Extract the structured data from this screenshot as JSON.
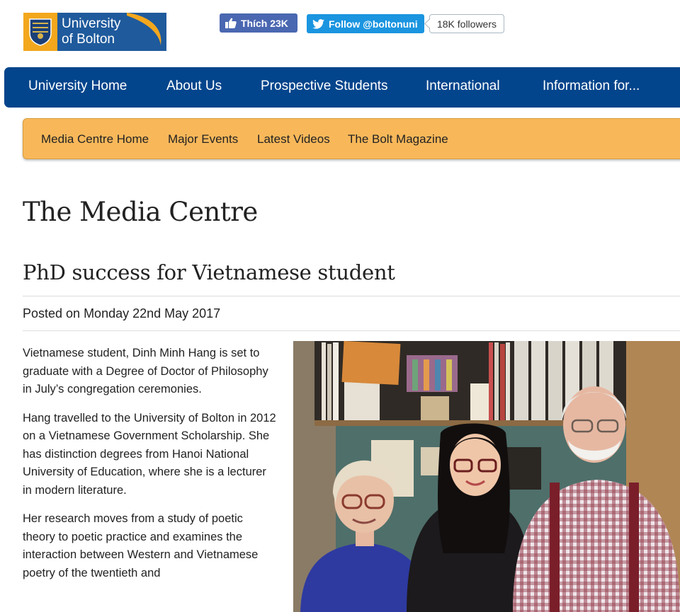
{
  "logo": {
    "line1": "University",
    "line2": "of Bolton"
  },
  "social": {
    "facebook_label": "Thích 23K",
    "twitter_label": "Follow @boltonuni",
    "twitter_count": "18K followers"
  },
  "main_nav": {
    "items": [
      {
        "label": "University Home"
      },
      {
        "label": "About Us"
      },
      {
        "label": "Prospective Students"
      },
      {
        "label": "International"
      },
      {
        "label": "Information for..."
      }
    ]
  },
  "sub_nav": {
    "items": [
      {
        "label": "Media Centre Home"
      },
      {
        "label": "Major Events"
      },
      {
        "label": "Latest Videos"
      },
      {
        "label": "The Bolt Magazine"
      }
    ]
  },
  "page_title": "The Media Centre",
  "article": {
    "title": "PhD success for Vietnamese student",
    "posted": "Posted on Monday 22nd May 2017",
    "paragraphs": [
      "Vietnamese student, Dinh Minh Hang is set to graduate with a Degree of Doctor of Philosophy in July’s congregation ceremonies.",
      "Hang travelled to the University of Bolton in 2012 on a Vietnamese Government Scholarship. She has distinction degrees from Hanoi National University of Education, where she is a lecturer in modern literature.",
      "Her research moves from a study of poetic theory to poetic practice and examines the interaction between Western and Vietnamese poetry of the twentieth and"
    ]
  },
  "colors": {
    "main_nav": "#03458c",
    "sub_nav": "#f8b85a",
    "facebook": "#4a67b1",
    "twitter": "#1b95e0",
    "logo_blue": "#1f5a9c",
    "logo_gold": "#f3a71d"
  }
}
